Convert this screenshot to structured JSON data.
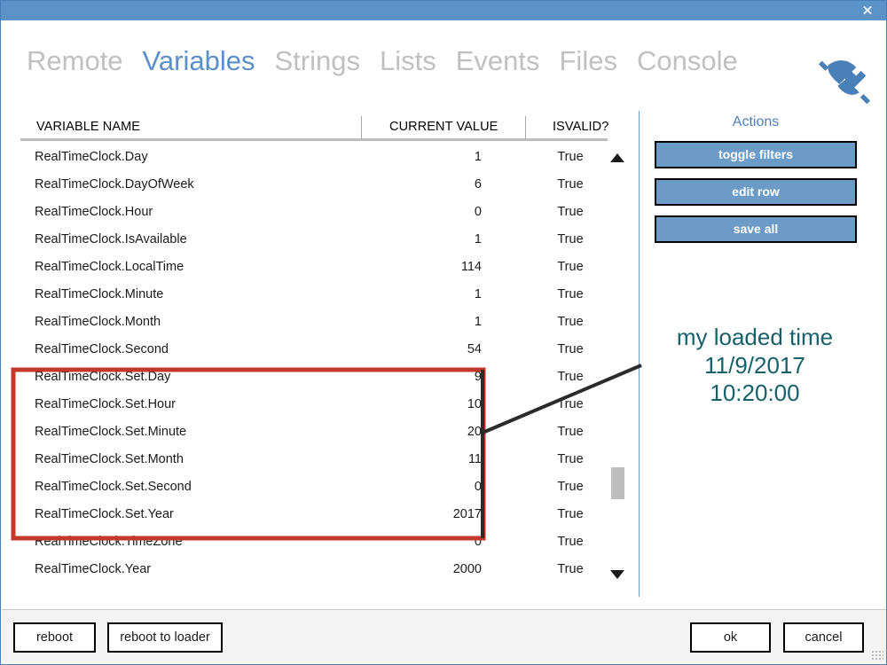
{
  "window": {
    "close_label": "✕",
    "titlebar_color": "#5b93c8"
  },
  "tabs": [
    {
      "label": "Remote",
      "active": false
    },
    {
      "label": "Variables",
      "active": true
    },
    {
      "label": "Strings",
      "active": false
    },
    {
      "label": "Lists",
      "active": false
    },
    {
      "label": "Events",
      "active": false
    },
    {
      "label": "Files",
      "active": false
    },
    {
      "label": "Console",
      "active": false
    }
  ],
  "header_icon": "plug-disconnected-icon",
  "table": {
    "columns": [
      "VARIABLE NAME",
      "CURRENT VALUE",
      "ISVALID?"
    ],
    "rows": [
      {
        "name": "RealTimeClock.Day",
        "value": "1",
        "valid": "True",
        "highlighted": false
      },
      {
        "name": "RealTimeClock.DayOfWeek",
        "value": "6",
        "valid": "True",
        "highlighted": false
      },
      {
        "name": "RealTimeClock.Hour",
        "value": "0",
        "valid": "True",
        "highlighted": false
      },
      {
        "name": "RealTimeClock.IsAvailable",
        "value": "1",
        "valid": "True",
        "highlighted": false
      },
      {
        "name": "RealTimeClock.LocalTime",
        "value": "114",
        "valid": "True",
        "highlighted": false
      },
      {
        "name": "RealTimeClock.Minute",
        "value": "1",
        "valid": "True",
        "highlighted": false
      },
      {
        "name": "RealTimeClock.Month",
        "value": "1",
        "valid": "True",
        "highlighted": false
      },
      {
        "name": "RealTimeClock.Second",
        "value": "54",
        "valid": "True",
        "highlighted": false
      },
      {
        "name": "RealTimeClock.Set.Day",
        "value": "9",
        "valid": "True",
        "highlighted": true
      },
      {
        "name": "RealTimeClock.Set.Hour",
        "value": "10",
        "valid": "True",
        "highlighted": true
      },
      {
        "name": "RealTimeClock.Set.Minute",
        "value": "20",
        "valid": "True",
        "highlighted": true
      },
      {
        "name": "RealTimeClock.Set.Month",
        "value": "11",
        "valid": "True",
        "highlighted": true
      },
      {
        "name": "RealTimeClock.Set.Second",
        "value": "0",
        "valid": "True",
        "highlighted": true
      },
      {
        "name": "RealTimeClock.Set.Year",
        "value": "2017",
        "valid": "True",
        "highlighted": true
      },
      {
        "name": "RealTimeClock.TimeZone",
        "value": "0",
        "valid": "True",
        "highlighted": false
      },
      {
        "name": "RealTimeClock.Year",
        "value": "2000",
        "valid": "True",
        "highlighted": false
      }
    ]
  },
  "actions": {
    "title": "Actions",
    "buttons": [
      {
        "label": "toggle filters"
      },
      {
        "label": "edit row"
      },
      {
        "label": "save all"
      }
    ],
    "button_color": "#6c9bc7"
  },
  "annotation": {
    "line1": "my loaded time",
    "line2": "11/9/2017",
    "line3": "10:20:00",
    "color": "#17616b",
    "highlight_color": "#c0392b"
  },
  "footer": {
    "reboot": "reboot",
    "reboot_to_loader": "reboot to loader",
    "ok": "ok",
    "cancel": "cancel"
  }
}
